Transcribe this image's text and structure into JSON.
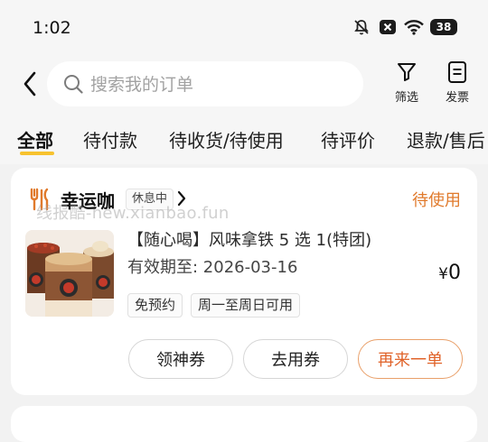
{
  "status_bar": {
    "time": "1:02",
    "battery": "38",
    "icons": [
      "mute-bell-icon",
      "close-box-icon",
      "wifi-icon",
      "battery-icon"
    ]
  },
  "header": {
    "search_placeholder": "搜索我的订单",
    "filter_label": "筛选",
    "invoice_label": "发票"
  },
  "tabs": [
    {
      "label": "全部",
      "active": true
    },
    {
      "label": "待付款",
      "active": false
    },
    {
      "label": "待收货/待使用",
      "active": false
    },
    {
      "label": "待评价",
      "active": false
    },
    {
      "label": "退款/售后",
      "active": false
    }
  ],
  "order": {
    "shop_name": "幸运咖",
    "shop_status": "休息中",
    "order_status": "待使用",
    "product_title": "【随心喝】风味拿铁 5 选 1(特团)",
    "validity": "有效期至: 2026-03-16",
    "price_symbol": "¥",
    "price_value": "0",
    "tags": [
      "免预约",
      "周一至周日可用"
    ],
    "buttons": [
      "领神券",
      "去用券",
      "再来一单"
    ]
  },
  "watermark": "线报酷-new.xianbao.fun",
  "colors": {
    "accent_orange": "#e07a2c",
    "tab_underline": "#f7c22f",
    "background": "#f2f2f2"
  }
}
